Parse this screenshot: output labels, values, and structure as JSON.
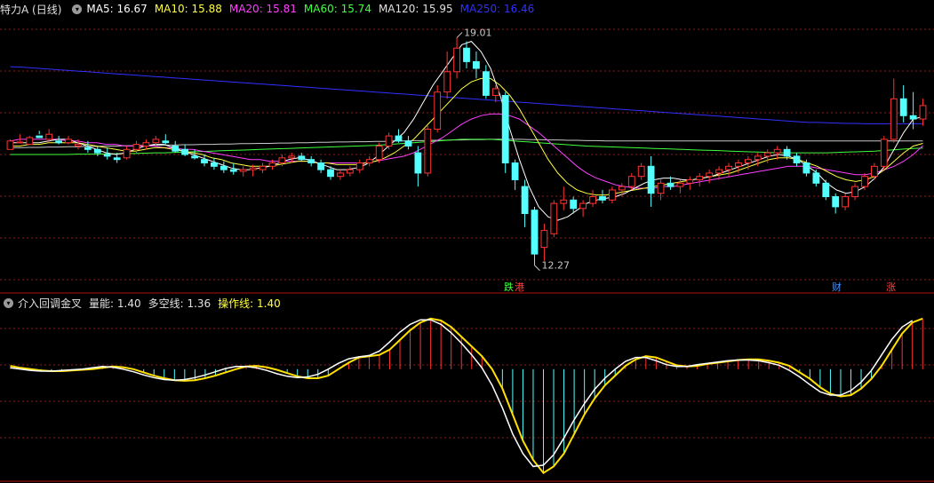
{
  "main_legend": {
    "title": "特力A (日线)",
    "items": [
      {
        "label": "MA5: 16.67",
        "color": "#ffffff"
      },
      {
        "label": "MA10: 15.88",
        "color": "#ffff40"
      },
      {
        "label": "MA20: 15.81",
        "color": "#ff40ff"
      },
      {
        "label": "MA60: 15.74",
        "color": "#40ff40"
      },
      {
        "label": "MA120: 15.95",
        "color": "#e0e0e0"
      },
      {
        "label": "MA250: 16.46",
        "color": "#3030ff"
      }
    ]
  },
  "indicator_legend": {
    "title": "介入回调金叉",
    "items": [
      {
        "label": "量能: 1.40",
        "color": "#e0e0e0"
      },
      {
        "label": "多空线: 1.36",
        "color": "#e0e0e0"
      },
      {
        "label": "操作线: 1.40",
        "color": "#ffff40"
      }
    ]
  },
  "annotations": {
    "high": "19.01",
    "low": "12.27",
    "tag_fall": "跌",
    "tag_port": "港",
    "tag_fin": "财",
    "tag_rise": "涨"
  },
  "colors": {
    "up": "#ff3232",
    "down": "#54ffff",
    "ma5": "#ffffff",
    "ma10": "#ffff40",
    "ma20": "#ff40ff",
    "ma60": "#40ff40",
    "ma120": "#c8c8c8",
    "ma250": "#3030ff",
    "grid": "#8c1c1c"
  },
  "chart_data": {
    "type": "candlestick",
    "y_range": [
      11.5,
      19.6
    ],
    "candles_ohlc": [
      [
        15.7,
        16.0,
        15.8,
        15.95
      ],
      [
        15.9,
        16.15,
        15.95,
        15.92
      ],
      [
        15.85,
        16.1,
        15.9,
        16.05
      ],
      [
        16.1,
        16.25,
        16.15,
        16.05
      ],
      [
        16.0,
        16.3,
        15.9,
        16.15
      ],
      [
        15.95,
        16.1,
        15.85,
        15.9
      ],
      [
        15.9,
        16.1,
        15.85,
        16.0
      ],
      [
        15.8,
        16.0,
        15.7,
        15.85
      ],
      [
        15.75,
        15.95,
        15.6,
        15.7
      ],
      [
        15.7,
        15.8,
        15.5,
        15.6
      ],
      [
        15.55,
        15.75,
        15.4,
        15.5
      ],
      [
        15.45,
        15.6,
        15.3,
        15.4
      ],
      [
        15.45,
        15.8,
        15.4,
        15.7
      ],
      [
        15.7,
        15.95,
        15.6,
        15.85
      ],
      [
        15.8,
        16.0,
        15.7,
        15.9
      ],
      [
        15.9,
        16.1,
        15.8,
        16.0
      ],
      [
        15.95,
        16.15,
        15.85,
        15.9
      ],
      [
        15.8,
        15.95,
        15.6,
        15.65
      ],
      [
        15.7,
        15.85,
        15.5,
        15.55
      ],
      [
        15.5,
        15.7,
        15.4,
        15.45
      ],
      [
        15.4,
        15.55,
        15.2,
        15.3
      ],
      [
        15.3,
        15.45,
        15.1,
        15.2
      ],
      [
        15.2,
        15.35,
        15.0,
        15.1
      ],
      [
        15.1,
        15.3,
        14.95,
        15.05
      ],
      [
        15.05,
        15.2,
        14.9,
        15.1
      ],
      [
        15.1,
        15.25,
        14.9,
        15.15
      ],
      [
        15.1,
        15.3,
        15.0,
        15.2
      ],
      [
        15.2,
        15.4,
        15.1,
        15.3
      ],
      [
        15.3,
        15.55,
        15.2,
        15.45
      ],
      [
        15.45,
        15.6,
        15.3,
        15.5
      ],
      [
        15.5,
        15.6,
        15.35,
        15.4
      ],
      [
        15.4,
        15.5,
        15.2,
        15.3
      ],
      [
        15.3,
        15.4,
        15.0,
        15.1
      ],
      [
        15.1,
        15.2,
        14.8,
        14.9
      ],
      [
        14.9,
        15.1,
        14.8,
        15.0
      ],
      [
        15.0,
        15.2,
        14.9,
        15.1
      ],
      [
        15.1,
        15.4,
        15.0,
        15.3
      ],
      [
        15.3,
        15.5,
        15.2,
        15.4
      ],
      [
        15.4,
        15.9,
        15.3,
        15.8
      ],
      [
        15.8,
        16.2,
        15.7,
        16.1
      ],
      [
        16.1,
        16.3,
        15.9,
        15.95
      ],
      [
        15.95,
        16.1,
        15.7,
        15.8
      ],
      [
        15.6,
        15.8,
        14.6,
        15.0
      ],
      [
        15.0,
        16.4,
        14.9,
        16.3
      ],
      [
        16.3,
        17.6,
        16.2,
        17.4
      ],
      [
        17.4,
        18.6,
        17.2,
        18.0
      ],
      [
        18.0,
        19.01,
        17.8,
        18.7
      ],
      [
        18.7,
        18.9,
        18.1,
        18.3
      ],
      [
        18.3,
        18.6,
        17.8,
        18.1
      ],
      [
        18.0,
        18.2,
        17.2,
        17.3
      ],
      [
        17.3,
        17.6,
        17.1,
        17.5
      ],
      [
        17.3,
        17.4,
        15.0,
        15.3
      ],
      [
        15.3,
        15.4,
        14.5,
        14.8
      ],
      [
        14.6,
        14.8,
        13.4,
        13.8
      ],
      [
        13.9,
        14.0,
        12.27,
        12.6
      ],
      [
        12.8,
        13.5,
        12.4,
        13.3
      ],
      [
        13.2,
        14.2,
        13.1,
        14.1
      ],
      [
        14.1,
        14.6,
        13.9,
        14.2
      ],
      [
        14.2,
        14.3,
        13.8,
        13.95
      ],
      [
        13.95,
        14.2,
        13.7,
        14.1
      ],
      [
        14.1,
        14.5,
        14.0,
        14.3
      ],
      [
        14.3,
        14.5,
        14.1,
        14.2
      ],
      [
        14.2,
        14.6,
        14.1,
        14.5
      ],
      [
        14.5,
        14.7,
        14.3,
        14.6
      ],
      [
        14.6,
        15.0,
        14.5,
        14.9
      ],
      [
        14.9,
        15.3,
        14.8,
        15.2
      ],
      [
        15.2,
        15.5,
        14.0,
        14.4
      ],
      [
        14.4,
        14.8,
        14.2,
        14.7
      ],
      [
        14.7,
        14.9,
        14.5,
        14.6
      ],
      [
        14.6,
        14.8,
        14.4,
        14.7
      ],
      [
        14.7,
        14.9,
        14.5,
        14.8
      ],
      [
        14.8,
        15.0,
        14.6,
        14.9
      ],
      [
        14.9,
        15.1,
        14.7,
        15.0
      ],
      [
        15.0,
        15.2,
        14.8,
        15.1
      ],
      [
        15.1,
        15.3,
        14.9,
        15.2
      ],
      [
        15.2,
        15.4,
        15.0,
        15.3
      ],
      [
        15.3,
        15.5,
        15.1,
        15.4
      ],
      [
        15.4,
        15.6,
        15.2,
        15.5
      ],
      [
        15.5,
        15.7,
        15.3,
        15.6
      ],
      [
        15.6,
        15.8,
        15.4,
        15.7
      ],
      [
        15.7,
        15.8,
        15.4,
        15.5
      ],
      [
        15.5,
        15.6,
        15.2,
        15.3
      ],
      [
        15.3,
        15.4,
        14.9,
        15.0
      ],
      [
        15.0,
        15.1,
        14.6,
        14.7
      ],
      [
        14.7,
        14.8,
        14.2,
        14.3
      ],
      [
        14.3,
        14.4,
        13.8,
        14.0
      ],
      [
        14.0,
        14.4,
        13.9,
        14.3
      ],
      [
        14.3,
        14.7,
        14.2,
        14.6
      ],
      [
        14.6,
        15.0,
        14.5,
        14.9
      ],
      [
        14.9,
        15.3,
        14.8,
        15.2
      ],
      [
        15.2,
        16.1,
        15.1,
        16.0
      ],
      [
        16.0,
        17.8,
        15.9,
        17.2
      ],
      [
        17.2,
        17.6,
        16.5,
        16.7
      ],
      [
        16.7,
        17.4,
        16.3,
        16.6
      ],
      [
        16.6,
        17.2,
        16.4,
        17.0
      ]
    ],
    "ma_series": {
      "ma5": [
        15.9,
        15.9,
        15.9,
        15.9,
        15.95,
        16.0,
        16.0,
        15.9,
        15.8,
        15.7,
        15.6,
        15.55,
        15.6,
        15.7,
        15.8,
        15.85,
        15.85,
        15.75,
        15.65,
        15.55,
        15.45,
        15.35,
        15.25,
        15.15,
        15.1,
        15.1,
        15.15,
        15.2,
        15.3,
        15.4,
        15.45,
        15.4,
        15.3,
        15.2,
        15.1,
        15.1,
        15.15,
        15.25,
        15.45,
        15.7,
        15.95,
        16.2,
        16.6,
        17.1,
        17.6,
        18.0,
        18.4,
        18.8,
        18.9,
        18.6,
        18.1,
        17.3,
        16.3,
        15.4,
        14.6,
        14.0,
        13.7,
        13.6,
        13.7,
        13.9,
        14.1,
        14.2,
        14.25,
        14.3,
        14.4,
        14.55,
        14.7,
        14.8,
        14.85,
        14.85,
        14.8,
        14.8,
        14.85,
        14.9,
        15.0,
        15.1,
        15.2,
        15.3,
        15.4,
        15.5,
        15.55,
        15.5,
        15.4,
        15.2,
        15.0,
        14.7,
        14.5,
        14.4,
        14.45,
        14.6,
        14.85,
        15.2,
        15.7,
        16.2,
        16.6,
        16.67
      ],
      "ma10": [
        15.8,
        15.8,
        15.85,
        15.85,
        15.9,
        15.9,
        15.9,
        15.9,
        15.85,
        15.8,
        15.75,
        15.7,
        15.65,
        15.65,
        15.7,
        15.75,
        15.75,
        15.7,
        15.65,
        15.6,
        15.55,
        15.45,
        15.4,
        15.3,
        15.25,
        15.2,
        15.2,
        15.2,
        15.25,
        15.3,
        15.35,
        15.35,
        15.3,
        15.3,
        15.25,
        15.25,
        15.25,
        15.3,
        15.35,
        15.45,
        15.6,
        15.8,
        16.0,
        16.3,
        16.6,
        16.9,
        17.2,
        17.5,
        17.7,
        17.8,
        17.8,
        17.6,
        17.3,
        16.9,
        16.4,
        15.9,
        15.4,
        15.0,
        14.7,
        14.5,
        14.4,
        14.35,
        14.35,
        14.4,
        14.45,
        14.5,
        14.55,
        14.6,
        14.65,
        14.7,
        14.75,
        14.8,
        14.85,
        14.9,
        14.95,
        15.0,
        15.1,
        15.2,
        15.3,
        15.4,
        15.45,
        15.45,
        15.4,
        15.3,
        15.2,
        15.05,
        14.9,
        14.8,
        14.75,
        14.8,
        14.9,
        15.1,
        15.35,
        15.6,
        15.8,
        15.88
      ],
      "ma20": [
        15.95,
        16.0,
        16.0,
        16.0,
        16.0,
        16.0,
        15.95,
        15.95,
        15.9,
        15.9,
        15.85,
        15.85,
        15.8,
        15.8,
        15.8,
        15.8,
        15.75,
        15.75,
        15.7,
        15.7,
        15.65,
        15.6,
        15.55,
        15.5,
        15.45,
        15.4,
        15.4,
        15.35,
        15.35,
        15.35,
        15.35,
        15.35,
        15.3,
        15.3,
        15.3,
        15.3,
        15.3,
        15.3,
        15.35,
        15.4,
        15.45,
        15.5,
        15.6,
        15.75,
        15.9,
        16.05,
        16.25,
        16.45,
        16.6,
        16.7,
        16.75,
        16.75,
        16.7,
        16.6,
        16.4,
        16.2,
        15.95,
        15.7,
        15.45,
        15.2,
        15.0,
        14.85,
        14.75,
        14.65,
        14.6,
        14.55,
        14.55,
        14.55,
        14.6,
        14.6,
        14.65,
        14.7,
        14.75,
        14.8,
        14.85,
        14.9,
        14.95,
        15.0,
        15.05,
        15.1,
        15.15,
        15.2,
        15.2,
        15.2,
        15.15,
        15.1,
        15.05,
        15.0,
        14.95,
        14.95,
        15.0,
        15.1,
        15.2,
        15.35,
        15.55,
        15.81
      ],
      "ma60": [
        15.55,
        15.55,
        15.55,
        15.55,
        15.55,
        15.55,
        15.55,
        15.56,
        15.56,
        15.56,
        15.57,
        15.57,
        15.58,
        15.58,
        15.59,
        15.6,
        15.6,
        15.61,
        15.62,
        15.63,
        15.64,
        15.65,
        15.66,
        15.67,
        15.68,
        15.69,
        15.7,
        15.71,
        15.72,
        15.73,
        15.74,
        15.75,
        15.76,
        15.77,
        15.78,
        15.79,
        15.8,
        15.81,
        15.82,
        15.84,
        15.86,
        15.88,
        15.9,
        15.92,
        15.94,
        15.96,
        15.98,
        16.0,
        16.0,
        16.0,
        16.0,
        15.98,
        15.96,
        15.94,
        15.92,
        15.9,
        15.88,
        15.86,
        15.84,
        15.82,
        15.8,
        15.79,
        15.78,
        15.77,
        15.76,
        15.75,
        15.74,
        15.73,
        15.72,
        15.71,
        15.7,
        15.69,
        15.68,
        15.67,
        15.66,
        15.65,
        15.64,
        15.63,
        15.62,
        15.61,
        15.6,
        15.6,
        15.6,
        15.6,
        15.6,
        15.6,
        15.61,
        15.62,
        15.63,
        15.64,
        15.65,
        15.67,
        15.69,
        15.71,
        15.73,
        15.74
      ],
      "ma120": [
        15.75,
        15.75,
        15.76,
        15.76,
        15.77,
        15.77,
        15.78,
        15.78,
        15.79,
        15.79,
        15.8,
        15.8,
        15.81,
        15.81,
        15.82,
        15.82,
        15.83,
        15.83,
        15.84,
        15.84,
        15.85,
        15.85,
        15.86,
        15.86,
        15.87,
        15.87,
        15.88,
        15.88,
        15.89,
        15.89,
        15.9,
        15.9,
        15.91,
        15.91,
        15.92,
        15.92,
        15.93,
        15.93,
        15.94,
        15.94,
        15.95,
        15.95,
        15.96,
        15.96,
        15.97,
        15.97,
        15.98,
        15.98,
        15.99,
        15.99,
        16.0,
        16.0,
        16.0,
        16.0,
        15.99,
        15.99,
        15.98,
        15.98,
        15.97,
        15.97,
        15.96,
        15.96,
        15.95,
        15.95,
        15.95,
        15.95,
        15.95,
        15.95,
        15.95,
        15.95,
        15.95,
        15.95,
        15.95,
        15.95,
        15.95,
        15.95,
        15.95,
        15.95,
        15.95,
        15.95,
        15.95,
        15.95,
        15.95,
        15.95,
        15.95,
        15.95,
        15.95,
        15.95,
        15.95,
        15.95,
        15.95,
        15.95,
        15.95,
        15.95,
        15.95,
        15.95
      ],
      "ma250": [
        18.15,
        18.14,
        18.12,
        18.1,
        18.08,
        18.06,
        18.04,
        18.02,
        18.0,
        17.98,
        17.96,
        17.94,
        17.92,
        17.9,
        17.88,
        17.86,
        17.84,
        17.82,
        17.8,
        17.78,
        17.76,
        17.74,
        17.72,
        17.7,
        17.68,
        17.66,
        17.64,
        17.62,
        17.6,
        17.58,
        17.56,
        17.54,
        17.52,
        17.5,
        17.48,
        17.46,
        17.44,
        17.42,
        17.4,
        17.38,
        17.36,
        17.34,
        17.32,
        17.3,
        17.28,
        17.26,
        17.24,
        17.22,
        17.2,
        17.18,
        17.16,
        17.14,
        17.12,
        17.1,
        17.08,
        17.06,
        17.04,
        17.02,
        17.0,
        16.98,
        16.96,
        16.94,
        16.92,
        16.9,
        16.88,
        16.86,
        16.84,
        16.82,
        16.8,
        16.78,
        16.76,
        16.74,
        16.72,
        16.7,
        16.68,
        16.66,
        16.64,
        16.62,
        16.6,
        16.58,
        16.56,
        16.54,
        16.52,
        16.5,
        16.5,
        16.49,
        16.48,
        16.47,
        16.47,
        16.46,
        16.46,
        16.46,
        16.46,
        16.46,
        16.46,
        16.46
      ]
    },
    "indicator": {
      "y_range": [
        -1.7,
        0.9
      ],
      "histogram": [
        0.05,
        0.02,
        0.0,
        -0.02,
        -0.03,
        -0.03,
        -0.02,
        -0.01,
        0.0,
        0.02,
        0.04,
        0.03,
        0.0,
        -0.05,
        -0.1,
        -0.14,
        -0.17,
        -0.18,
        -0.17,
        -0.14,
        -0.1,
        -0.05,
        0.0,
        0.04,
        0.05,
        0.03,
        -0.01,
        -0.06,
        -0.11,
        -0.14,
        -0.14,
        -0.1,
        0.0,
        0.1,
        0.18,
        0.2,
        0.22,
        0.3,
        0.45,
        0.6,
        0.72,
        0.78,
        0.75,
        0.65,
        0.5,
        0.35,
        0.2,
        0.0,
        -0.3,
        -0.7,
        -1.1,
        -1.4,
        -1.6,
        -1.5,
        -1.3,
        -1.0,
        -0.7,
        -0.45,
        -0.25,
        -0.1,
        0.05,
        0.15,
        0.2,
        0.18,
        0.12,
        0.06,
        0.04,
        0.05,
        0.08,
        0.1,
        0.12,
        0.14,
        0.15,
        0.15,
        0.13,
        0.1,
        0.05,
        -0.05,
        -0.15,
        -0.28,
        -0.38,
        -0.42,
        -0.4,
        -0.3,
        -0.15,
        0.05,
        0.3,
        0.55,
        0.72,
        0.78
      ],
      "long_short": [
        0.02,
        0.0,
        -0.02,
        -0.03,
        -0.03,
        -0.02,
        -0.01,
        0.0,
        0.02,
        0.04,
        0.03,
        0.0,
        -0.04,
        -0.09,
        -0.13,
        -0.16,
        -0.17,
        -0.16,
        -0.13,
        -0.09,
        -0.04,
        0.01,
        0.04,
        0.04,
        0.02,
        -0.02,
        -0.07,
        -0.11,
        -0.13,
        -0.12,
        -0.08,
        0.0,
        0.09,
        0.16,
        0.19,
        0.21,
        0.28,
        0.42,
        0.57,
        0.69,
        0.76,
        0.76,
        0.69,
        0.56,
        0.4,
        0.22,
        0.02,
        -0.25,
        -0.6,
        -1.0,
        -1.3,
        -1.5,
        -1.48,
        -1.32,
        -1.06,
        -0.78,
        -0.53,
        -0.31,
        -0.14,
        0.0,
        0.12,
        0.18,
        0.18,
        0.13,
        0.07,
        0.04,
        0.04,
        0.07,
        0.09,
        0.11,
        0.13,
        0.14,
        0.14,
        0.13,
        0.1,
        0.06,
        -0.02,
        -0.12,
        -0.24,
        -0.35,
        -0.4,
        -0.4,
        -0.33,
        -0.2,
        -0.02,
        0.22,
        0.46,
        0.65,
        0.75
      ]
    }
  }
}
